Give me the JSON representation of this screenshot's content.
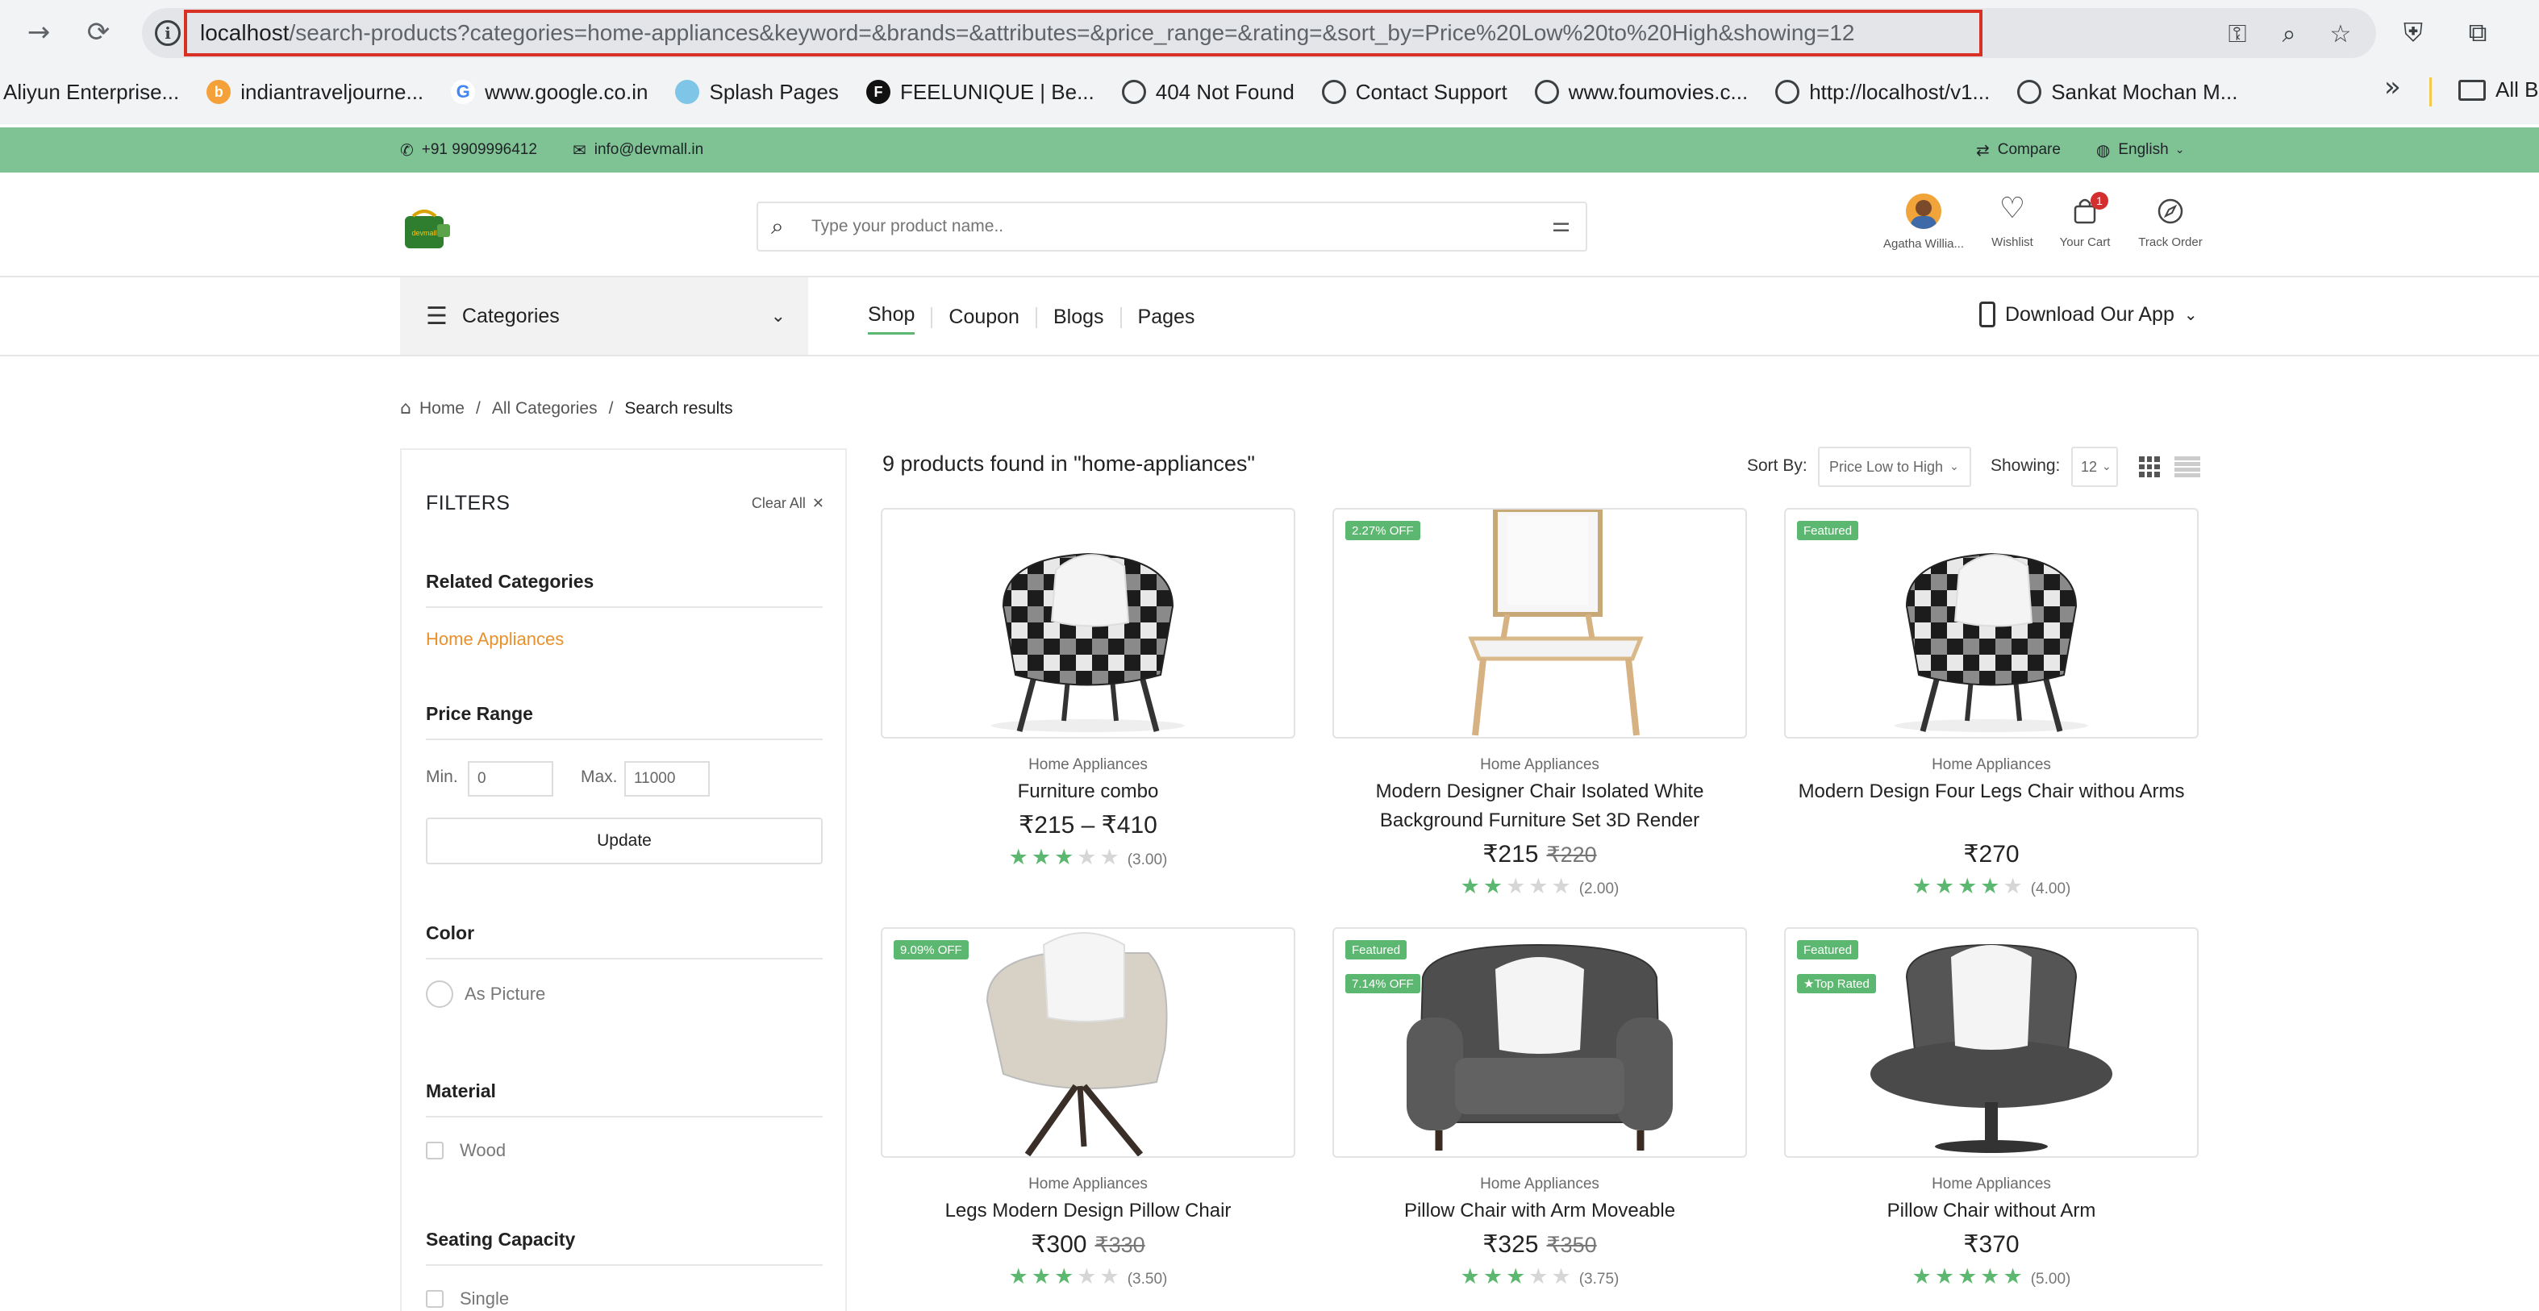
{
  "browser": {
    "url_host": "localhost",
    "url_rest": "/search-products?categories=home-appliances&keyword=&brands=&attributes=&price_range=&rating=&sort_by=Price%20Low%20to%20High&showing=12",
    "bookmarks": [
      {
        "label": "Aliyun Enterprise...",
        "icon_color": "#ffffff",
        "icon": ""
      },
      {
        "label": "indiantraveljourne...",
        "icon_color": "#f4a13a",
        "icon": "b"
      },
      {
        "label": "www.google.co.in",
        "icon_color": "#ffffff",
        "icon": "G"
      },
      {
        "label": "Splash Pages",
        "icon_color": "#7fc5e8",
        "icon": ""
      },
      {
        "label": "FEELUNIQUE | Be...",
        "icon_color": "#111111",
        "icon": "F"
      },
      {
        "label": "404 Not Found",
        "icon_color": "#3c4043",
        "icon": ""
      },
      {
        "label": "Contact Support",
        "icon_color": "#3c4043",
        "icon": ""
      },
      {
        "label": "www.foumovies.c...",
        "icon_color": "#3c4043",
        "icon": ""
      },
      {
        "label": "http://localhost/v1...",
        "icon_color": "#3c4043",
        "icon": ""
      },
      {
        "label": "Sankat Mochan M...",
        "icon_color": "#3c4043",
        "icon": ""
      }
    ],
    "bookmarks_more": "»",
    "all_bookmarks": "All B"
  },
  "topbar": {
    "phone": "+91 9909996412",
    "email": "info@devmall.in",
    "compare": "Compare",
    "language": "English"
  },
  "header": {
    "search_placeholder": "Type your product name..",
    "user_name": "Agatha Willia...",
    "wishlist": "Wishlist",
    "cart": "Your Cart",
    "cart_count": "1",
    "track": "Track Order",
    "logo_text": "devmall"
  },
  "nav": {
    "categories": "Categories",
    "links": [
      "Shop",
      "Coupon",
      "Blogs",
      "Pages"
    ],
    "download_app": "Download Our App"
  },
  "breadcrumb": {
    "home": "Home",
    "all_categories": "All Categories",
    "current": "Search results",
    "sep": "/"
  },
  "filters": {
    "title": "FILTERS",
    "clear_all": "Clear All",
    "related_categories": "Related Categories",
    "category_item": "Home Appliances",
    "price_range": "Price Range",
    "min_label": "Min.",
    "min_value": "0",
    "max_label": "Max.",
    "max_value": "11000",
    "update": "Update",
    "color": "Color",
    "color_option": "As Picture",
    "material": "Material",
    "material_option": "Wood",
    "seating": "Seating Capacity",
    "seating_option": "Single"
  },
  "results": {
    "count_text": "9 products found in \"home-appliances\"",
    "sort_label": "Sort By:",
    "sort_value": "Price Low to High",
    "showing_label": "Showing:",
    "showing_value": "12"
  },
  "products": [
    {
      "category": "Home Appliances",
      "name": "Furniture combo",
      "price": "₹215 – ₹410",
      "old_price": "",
      "rating": 3,
      "rating_text": "(3.00)",
      "badges": []
    },
    {
      "category": "Home Appliances",
      "name": "Modern Designer Chair Isolated White Background Furniture Set 3D Render",
      "price": "₹215",
      "old_price": "₹220",
      "rating": 2,
      "rating_text": "(2.00)",
      "badges": [
        "2.27% OFF"
      ]
    },
    {
      "category": "Home Appliances",
      "name": "Modern Design Four Legs Chair withou Arms",
      "price": "₹270",
      "old_price": "",
      "rating": 4,
      "rating_text": "(4.00)",
      "badges": [
        "Featured"
      ]
    },
    {
      "category": "Home Appliances",
      "name": "Legs Modern Design Pillow Chair",
      "price": "₹300",
      "old_price": "₹330",
      "rating": 3,
      "rating_text": "(3.50)",
      "badges": [
        "9.09% OFF"
      ]
    },
    {
      "category": "Home Appliances",
      "name": "Pillow Chair with Arm Moveable",
      "price": "₹325",
      "old_price": "₹350",
      "rating": 3,
      "rating_text": "(3.75)",
      "badges": [
        "Featured",
        "7.14% OFF"
      ]
    },
    {
      "category": "Home Appliances",
      "name": "Pillow Chair without Arm",
      "price": "₹370",
      "old_price": "",
      "rating": 5,
      "rating_text": "(5.00)",
      "badges": [
        "Featured",
        "★Top Rated"
      ]
    }
  ],
  "colors": {
    "brand_green": "#5cb870",
    "topbar_green": "#7fc394",
    "category_orange": "#e8912d",
    "url_highlight": "#d93025"
  }
}
